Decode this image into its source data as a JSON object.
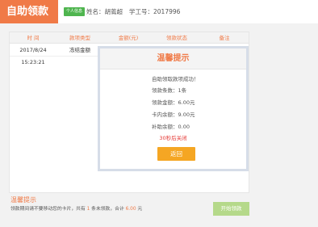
{
  "header": {
    "title": "自助领款",
    "badge": "个人信息",
    "name_label": "姓名：胡蔫超",
    "id_label": "学工号：2017996"
  },
  "table": {
    "columns": [
      "时 间",
      "款项类型",
      "金额(元)",
      "领款状态",
      "备注"
    ],
    "rows": [
      {
        "time": "2017/8/24 15:23:21",
        "type": "冻结金额"
      }
    ]
  },
  "modal": {
    "title": "温馨提示",
    "success": "自助领取款项成功！",
    "count_line": "领款条数：1条",
    "amount_line": "领款金额：6.00元",
    "card_balance_line": "卡内余额：9.00元",
    "supplement_line": "补助余额：0.00",
    "countdown": "30秒后关闭",
    "return_label": "返回"
  },
  "footer": {
    "tip_title": "温馨提示",
    "tip_pre": "领款期间请不要移动您的卡片，共有",
    "tip_count": "1",
    "tip_mid": "条未领款，合计",
    "tip_amount": "6.00",
    "tip_unit": "元",
    "start_label": "开始领款"
  },
  "colors": {
    "accent": "#f07a47",
    "badge": "#4fb54f",
    "return_button": "#f5a623",
    "start_button_disabled": "#b5d98a",
    "countdown": "#e53935"
  }
}
